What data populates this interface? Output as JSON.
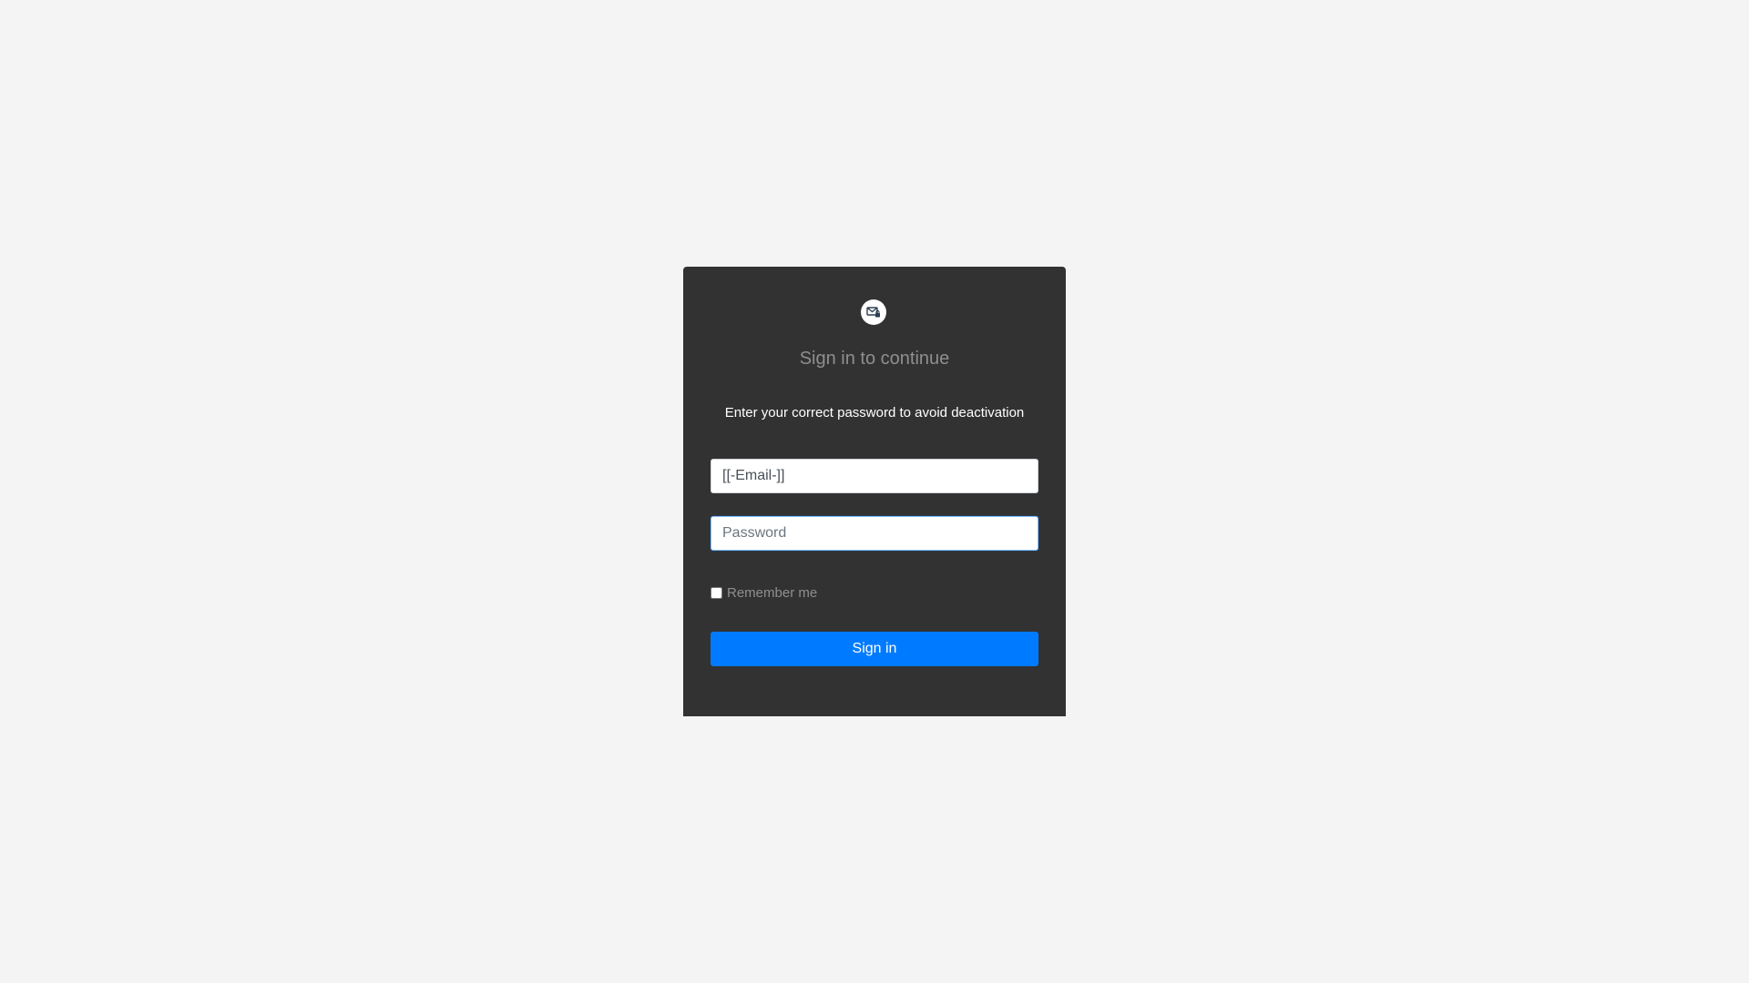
{
  "card": {
    "logo_icon": "mail-lock-icon",
    "title": "Sign in to continue",
    "subtitle": "Enter your correct password to avoid deactivation"
  },
  "form": {
    "email_value": "[[-Email-]]",
    "password_placeholder": "Password",
    "remember_label": "Remember me",
    "remember_checked": false,
    "submit_label": "Sign in"
  },
  "colors": {
    "page_background": "#f4f4f4",
    "card_background": "#323232",
    "accent": "#007bff",
    "muted_text": "#8f8f8f"
  }
}
